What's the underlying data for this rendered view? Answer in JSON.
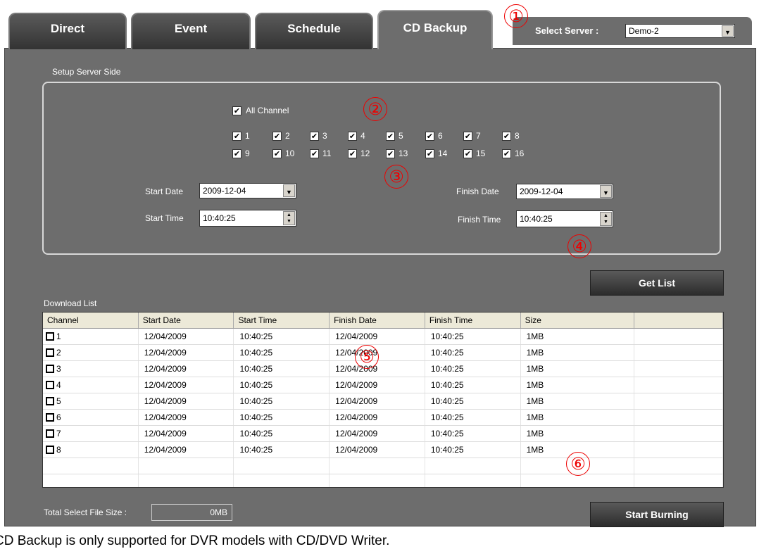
{
  "tabs": [
    {
      "label": "Direct"
    },
    {
      "label": "Event"
    },
    {
      "label": "Schedule"
    },
    {
      "label": "CD Backup"
    }
  ],
  "server": {
    "label": "Select Server :",
    "value": "Demo-2"
  },
  "setup": {
    "group_title": "Setup Server Side",
    "all_channel": "All Channel",
    "channels": [
      "1",
      "2",
      "3",
      "4",
      "5",
      "6",
      "7",
      "8",
      "9",
      "10",
      "11",
      "12",
      "13",
      "14",
      "15",
      "16"
    ],
    "start_date_label": "Start Date",
    "start_date": "2009-12-04",
    "start_time_label": "Start Time",
    "start_time": "10:40:25",
    "finish_date_label": "Finish Date",
    "finish_date": "2009-12-04",
    "finish_time_label": "Finish Time",
    "finish_time": "10:40:25"
  },
  "get_list_label": "Get List",
  "download": {
    "title": "Download List",
    "columns": [
      "Channel",
      "Start Date",
      "Start Time",
      "Finish Date",
      "Finish Time",
      "Size"
    ],
    "rows": [
      [
        "1",
        "12/04/2009",
        "10:40:25",
        "12/04/2009",
        "10:40:25",
        "1MB"
      ],
      [
        "2",
        "12/04/2009",
        "10:40:25",
        "12/04/2009",
        "10:40:25",
        "1MB"
      ],
      [
        "3",
        "12/04/2009",
        "10:40:25",
        "12/04/2009",
        "10:40:25",
        "1MB"
      ],
      [
        "4",
        "12/04/2009",
        "10:40:25",
        "12/04/2009",
        "10:40:25",
        "1MB"
      ],
      [
        "5",
        "12/04/2009",
        "10:40:25",
        "12/04/2009",
        "10:40:25",
        "1MB"
      ],
      [
        "6",
        "12/04/2009",
        "10:40:25",
        "12/04/2009",
        "10:40:25",
        "1MB"
      ],
      [
        "7",
        "12/04/2009",
        "10:40:25",
        "12/04/2009",
        "10:40:25",
        "1MB"
      ],
      [
        "8",
        "12/04/2009",
        "10:40:25",
        "12/04/2009",
        "10:40:25",
        "1MB"
      ]
    ]
  },
  "total": {
    "label": "Total Select File Size :",
    "value": "0MB"
  },
  "start_burning_label": "Start Burning",
  "markers": [
    "①",
    "②",
    "③",
    "④",
    "⑤",
    "⑥"
  ],
  "caption": "CD Backup is only supported for DVR models with CD/DVD Writer.",
  "colors": {
    "panel": "#6d6d6d",
    "marker": "#e00000"
  }
}
